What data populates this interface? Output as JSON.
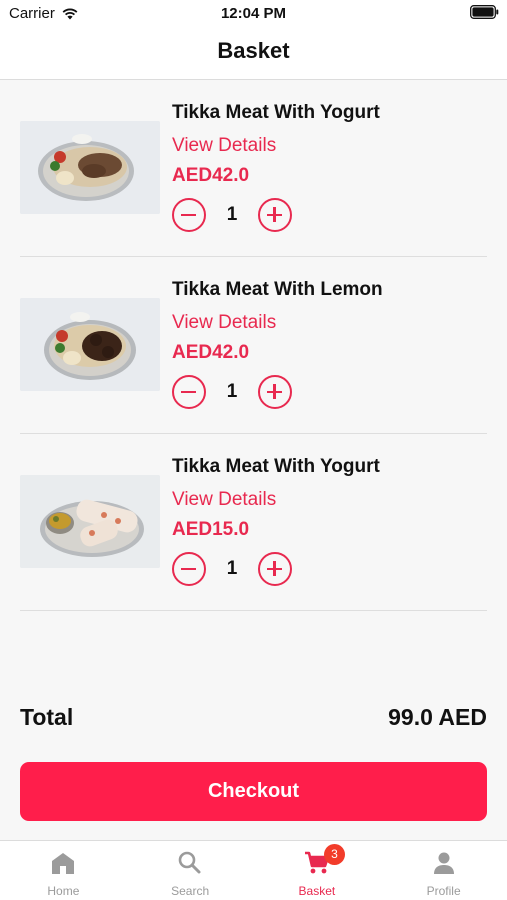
{
  "status_bar": {
    "carrier": "Carrier",
    "time": "12:04 PM"
  },
  "header": {
    "title": "Basket"
  },
  "items": [
    {
      "name": "Tikka Meat With Yogurt",
      "details_label": "View Details",
      "price": "AED42.0",
      "quantity": "1"
    },
    {
      "name": "Tikka Meat With Lemon",
      "details_label": "View Details",
      "price": "AED42.0",
      "quantity": "1"
    },
    {
      "name": "Tikka Meat With Yogurt",
      "details_label": "View Details",
      "price": "AED15.0",
      "quantity": "1"
    }
  ],
  "summary": {
    "total_label": "Total",
    "total_value": "99.0 AED"
  },
  "checkout": {
    "label": "Checkout"
  },
  "tabs": [
    {
      "label": "Home",
      "icon": "home-icon"
    },
    {
      "label": "Search",
      "icon": "search-icon"
    },
    {
      "label": "Basket",
      "icon": "cart-icon"
    },
    {
      "label": "Profile",
      "icon": "person-icon"
    }
  ],
  "basket_badge": "3",
  "colors": {
    "accent": "#e8294f",
    "checkout": "#ff1e4b",
    "badge": "#f23c2a",
    "tab_inactive": "#9b9b9b"
  }
}
